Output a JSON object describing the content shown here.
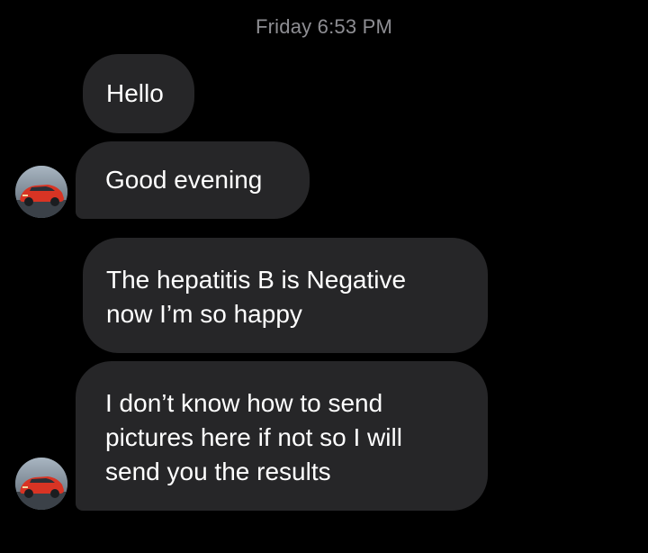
{
  "conversation": {
    "timestamp": "Friday 6:53 PM",
    "messages": [
      {
        "text": "Hello"
      },
      {
        "text": "Good evening"
      },
      {
        "text": "The hepatitis B is Negative\nnow I’m so happy"
      },
      {
        "text": "I don’t know how to send\npictures here if not so I will\nsend you the results"
      }
    ]
  },
  "colors": {
    "background": "#000000",
    "bubble": "#262628",
    "timestamp_text": "#8e8e93",
    "message_text": "#ffffff",
    "avatar_car": "#e0392b"
  },
  "icons": {
    "avatar": "red-sports-car-avatar"
  }
}
